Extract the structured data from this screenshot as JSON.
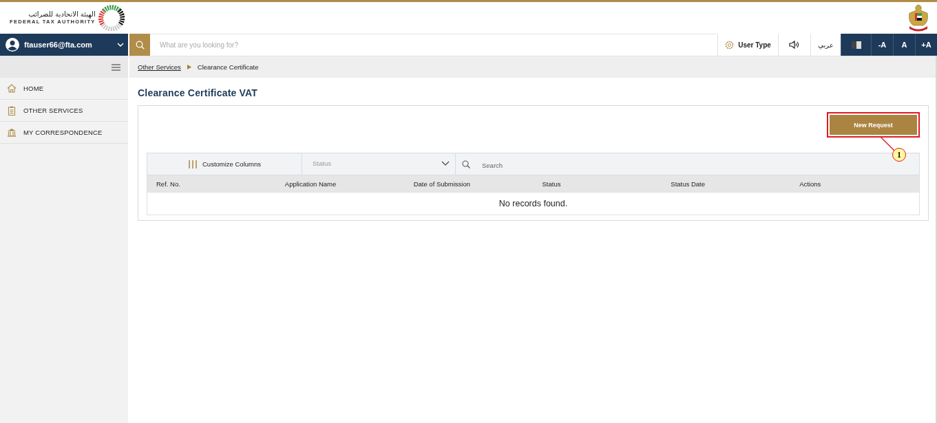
{
  "header": {
    "logo_arabic": "الهيئة الاتحادية للضرائب",
    "logo_english": "FEDERAL TAX AUTHORITY"
  },
  "user_menu": {
    "email": "ftauser66@fta.com"
  },
  "search": {
    "placeholder": "What are you looking for?"
  },
  "toolbar": [
    {
      "kind": "user-type",
      "label": "User Type"
    },
    {
      "kind": "speaker"
    },
    {
      "kind": "language",
      "label": "عربي"
    },
    {
      "kind": "contrast"
    },
    {
      "kind": "font",
      "label": "-A"
    },
    {
      "kind": "font",
      "label": "A"
    },
    {
      "kind": "font",
      "label": "+A"
    }
  ],
  "sidebar": {
    "items": [
      {
        "label": "HOME"
      },
      {
        "label": "OTHER SERVICES"
      },
      {
        "label": "MY CORRESPONDENCE"
      }
    ]
  },
  "breadcrumb": [
    {
      "kind": "link",
      "label": "Other Services"
    },
    {
      "kind": "current",
      "label": "Clearance Certificate"
    }
  ],
  "page_title": "Clearance Certificate VAT",
  "new_request_button": {
    "label": "New Request",
    "highlighted": true
  },
  "annotation": {
    "number": "1"
  },
  "table": {
    "customize_label": "Customize Columns",
    "status_filter": {
      "placeholder": "Status"
    },
    "search": {
      "placeholder": "Search"
    },
    "columns": [
      "Ref. No.",
      "Application Name",
      "Date of Submission",
      "Status",
      "Status Date",
      "Actions"
    ],
    "empty_message": "No records found."
  }
}
